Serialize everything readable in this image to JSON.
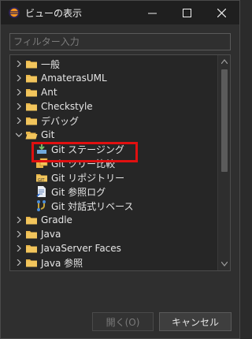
{
  "window": {
    "title": "ビューの表示",
    "min_label": "—",
    "max_label": "□",
    "close_label": "✕"
  },
  "filter": {
    "placeholder": "フィルター入力"
  },
  "tree": {
    "items": [
      {
        "label": "一般",
        "expanded": false,
        "icon": "folder-icon"
      },
      {
        "label": "AmaterasUML",
        "expanded": false,
        "icon": "folder-icon"
      },
      {
        "label": "Ant",
        "expanded": false,
        "icon": "folder-icon"
      },
      {
        "label": "Checkstyle",
        "expanded": false,
        "icon": "folder-icon"
      },
      {
        "label": "デバッグ",
        "expanded": false,
        "icon": "folder-icon"
      },
      {
        "label": "Git",
        "expanded": true,
        "icon": "folder-open-icon"
      },
      {
        "label": "Git ステージング",
        "icon": "git-staging-icon"
      },
      {
        "label": "Git ツリー比較",
        "icon": "git-tree-compare-icon"
      },
      {
        "label": "Git リポジトリー",
        "icon": "git-repository-icon"
      },
      {
        "label": "Git 参照ログ",
        "icon": "git-reflog-icon"
      },
      {
        "label": "Git 対話式リベース",
        "icon": "git-rebase-icon"
      },
      {
        "label": "Gradle",
        "expanded": false,
        "icon": "folder-icon"
      },
      {
        "label": "Java",
        "expanded": false,
        "icon": "folder-icon"
      },
      {
        "label": "JavaServer Faces",
        "expanded": false,
        "icon": "folder-icon"
      },
      {
        "label": "Java 参照",
        "expanded": false,
        "icon": "folder-icon"
      }
    ]
  },
  "buttons": {
    "open_label": "開く(O)",
    "cancel_label": "キャンセル"
  },
  "colors": {
    "highlight": "#e01010",
    "folder": "#e8b64a",
    "background": "#2f2f2f"
  }
}
